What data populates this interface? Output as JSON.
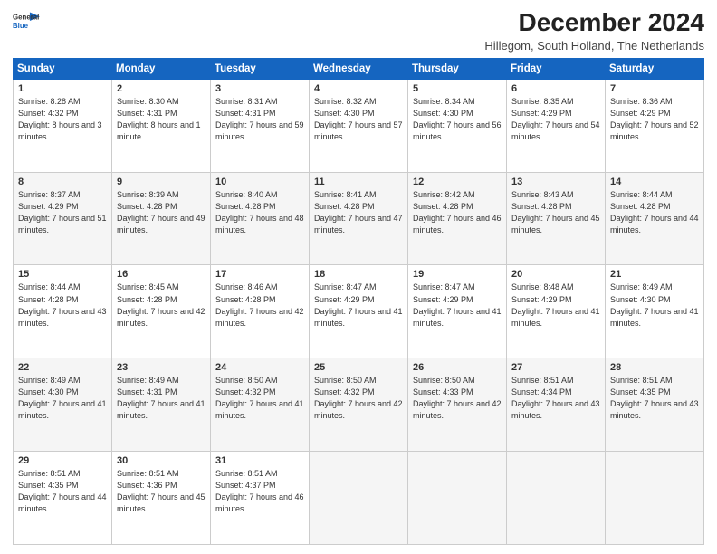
{
  "header": {
    "logo_line1": "General",
    "logo_line2": "Blue",
    "main_title": "December 2024",
    "subtitle": "Hillegom, South Holland, The Netherlands"
  },
  "days_of_week": [
    "Sunday",
    "Monday",
    "Tuesday",
    "Wednesday",
    "Thursday",
    "Friday",
    "Saturday"
  ],
  "weeks": [
    [
      {
        "day": "1",
        "sunrise": "8:28 AM",
        "sunset": "4:32 PM",
        "daylight": "8 hours and 3 minutes."
      },
      {
        "day": "2",
        "sunrise": "8:30 AM",
        "sunset": "4:31 PM",
        "daylight": "8 hours and 1 minute."
      },
      {
        "day": "3",
        "sunrise": "8:31 AM",
        "sunset": "4:31 PM",
        "daylight": "7 hours and 59 minutes."
      },
      {
        "day": "4",
        "sunrise": "8:32 AM",
        "sunset": "4:30 PM",
        "daylight": "7 hours and 57 minutes."
      },
      {
        "day": "5",
        "sunrise": "8:34 AM",
        "sunset": "4:30 PM",
        "daylight": "7 hours and 56 minutes."
      },
      {
        "day": "6",
        "sunrise": "8:35 AM",
        "sunset": "4:29 PM",
        "daylight": "7 hours and 54 minutes."
      },
      {
        "day": "7",
        "sunrise": "8:36 AM",
        "sunset": "4:29 PM",
        "daylight": "7 hours and 52 minutes."
      }
    ],
    [
      {
        "day": "8",
        "sunrise": "8:37 AM",
        "sunset": "4:29 PM",
        "daylight": "7 hours and 51 minutes."
      },
      {
        "day": "9",
        "sunrise": "8:39 AM",
        "sunset": "4:28 PM",
        "daylight": "7 hours and 49 minutes."
      },
      {
        "day": "10",
        "sunrise": "8:40 AM",
        "sunset": "4:28 PM",
        "daylight": "7 hours and 48 minutes."
      },
      {
        "day": "11",
        "sunrise": "8:41 AM",
        "sunset": "4:28 PM",
        "daylight": "7 hours and 47 minutes."
      },
      {
        "day": "12",
        "sunrise": "8:42 AM",
        "sunset": "4:28 PM",
        "daylight": "7 hours and 46 minutes."
      },
      {
        "day": "13",
        "sunrise": "8:43 AM",
        "sunset": "4:28 PM",
        "daylight": "7 hours and 45 minutes."
      },
      {
        "day": "14",
        "sunrise": "8:44 AM",
        "sunset": "4:28 PM",
        "daylight": "7 hours and 44 minutes."
      }
    ],
    [
      {
        "day": "15",
        "sunrise": "8:44 AM",
        "sunset": "4:28 PM",
        "daylight": "7 hours and 43 minutes."
      },
      {
        "day": "16",
        "sunrise": "8:45 AM",
        "sunset": "4:28 PM",
        "daylight": "7 hours and 42 minutes."
      },
      {
        "day": "17",
        "sunrise": "8:46 AM",
        "sunset": "4:28 PM",
        "daylight": "7 hours and 42 minutes."
      },
      {
        "day": "18",
        "sunrise": "8:47 AM",
        "sunset": "4:29 PM",
        "daylight": "7 hours and 41 minutes."
      },
      {
        "day": "19",
        "sunrise": "8:47 AM",
        "sunset": "4:29 PM",
        "daylight": "7 hours and 41 minutes."
      },
      {
        "day": "20",
        "sunrise": "8:48 AM",
        "sunset": "4:29 PM",
        "daylight": "7 hours and 41 minutes."
      },
      {
        "day": "21",
        "sunrise": "8:49 AM",
        "sunset": "4:30 PM",
        "daylight": "7 hours and 41 minutes."
      }
    ],
    [
      {
        "day": "22",
        "sunrise": "8:49 AM",
        "sunset": "4:30 PM",
        "daylight": "7 hours and 41 minutes."
      },
      {
        "day": "23",
        "sunrise": "8:49 AM",
        "sunset": "4:31 PM",
        "daylight": "7 hours and 41 minutes."
      },
      {
        "day": "24",
        "sunrise": "8:50 AM",
        "sunset": "4:32 PM",
        "daylight": "7 hours and 41 minutes."
      },
      {
        "day": "25",
        "sunrise": "8:50 AM",
        "sunset": "4:32 PM",
        "daylight": "7 hours and 42 minutes."
      },
      {
        "day": "26",
        "sunrise": "8:50 AM",
        "sunset": "4:33 PM",
        "daylight": "7 hours and 42 minutes."
      },
      {
        "day": "27",
        "sunrise": "8:51 AM",
        "sunset": "4:34 PM",
        "daylight": "7 hours and 43 minutes."
      },
      {
        "day": "28",
        "sunrise": "8:51 AM",
        "sunset": "4:35 PM",
        "daylight": "7 hours and 43 minutes."
      }
    ],
    [
      {
        "day": "29",
        "sunrise": "8:51 AM",
        "sunset": "4:35 PM",
        "daylight": "7 hours and 44 minutes."
      },
      {
        "day": "30",
        "sunrise": "8:51 AM",
        "sunset": "4:36 PM",
        "daylight": "7 hours and 45 minutes."
      },
      {
        "day": "31",
        "sunrise": "8:51 AM",
        "sunset": "4:37 PM",
        "daylight": "7 hours and 46 minutes."
      },
      null,
      null,
      null,
      null
    ]
  ],
  "labels": {
    "sunrise": "Sunrise:",
    "sunset": "Sunset:",
    "daylight": "Daylight:"
  }
}
